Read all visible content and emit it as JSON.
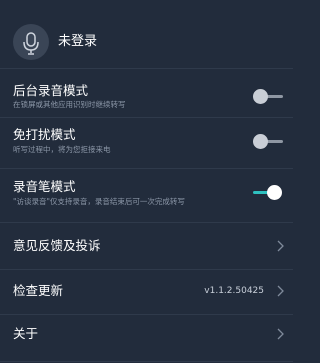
{
  "profile": {
    "avatar_icon": "microphone-avatar-icon",
    "username": "未登录"
  },
  "settings": {
    "background_recording": {
      "title": "后台录音模式",
      "subtitle": "在锁屏或其他应用识别时继续转写",
      "enabled": false
    },
    "do_not_disturb": {
      "title": "免打扰模式",
      "subtitle": "听写过程中，将为您拒接来电",
      "enabled": false
    },
    "recorder_pen": {
      "title": "录音笔模式",
      "subtitle": "\"访谈录音\"仅支持录音，录音结束后可一次完成转写",
      "enabled": true
    }
  },
  "menu": {
    "feedback": {
      "label": "意见反馈及投诉",
      "icon": "chevron-right-icon"
    },
    "update": {
      "label": "检查更新",
      "version": "v1.1.2.50425",
      "icon": "chevron-right-icon"
    },
    "about": {
      "label": "关于",
      "icon": "chevron-right-icon"
    }
  },
  "colors": {
    "background": "#222c3c",
    "accent": "#2fc1c0",
    "divider": "#2f3a4b",
    "subtext": "#8c97a8"
  }
}
